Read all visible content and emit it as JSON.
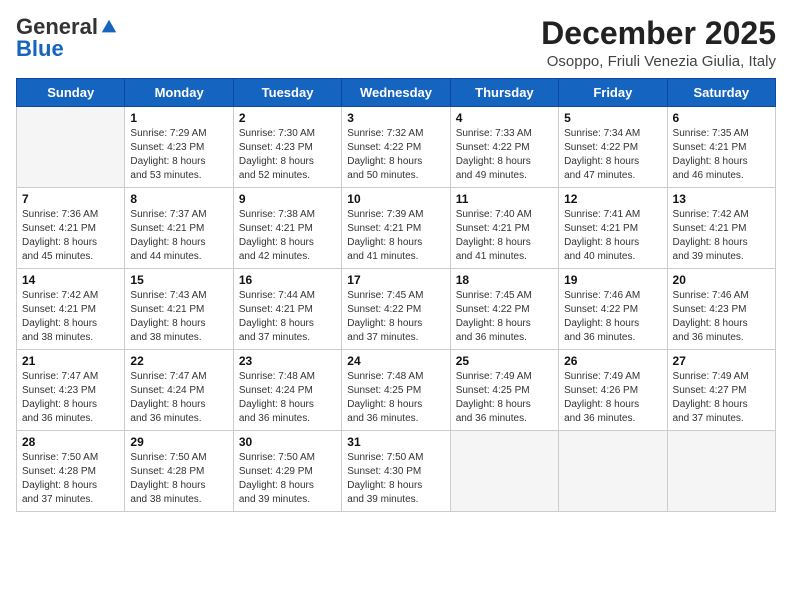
{
  "logo": {
    "general": "General",
    "blue": "Blue"
  },
  "title": "December 2025",
  "subtitle": "Osoppo, Friuli Venezia Giulia, Italy",
  "days_header": [
    "Sunday",
    "Monday",
    "Tuesday",
    "Wednesday",
    "Thursday",
    "Friday",
    "Saturday"
  ],
  "weeks": [
    [
      {
        "day": "",
        "info": ""
      },
      {
        "day": "1",
        "info": "Sunrise: 7:29 AM\nSunset: 4:23 PM\nDaylight: 8 hours\nand 53 minutes."
      },
      {
        "day": "2",
        "info": "Sunrise: 7:30 AM\nSunset: 4:23 PM\nDaylight: 8 hours\nand 52 minutes."
      },
      {
        "day": "3",
        "info": "Sunrise: 7:32 AM\nSunset: 4:22 PM\nDaylight: 8 hours\nand 50 minutes."
      },
      {
        "day": "4",
        "info": "Sunrise: 7:33 AM\nSunset: 4:22 PM\nDaylight: 8 hours\nand 49 minutes."
      },
      {
        "day": "5",
        "info": "Sunrise: 7:34 AM\nSunset: 4:22 PM\nDaylight: 8 hours\nand 47 minutes."
      },
      {
        "day": "6",
        "info": "Sunrise: 7:35 AM\nSunset: 4:21 PM\nDaylight: 8 hours\nand 46 minutes."
      }
    ],
    [
      {
        "day": "7",
        "info": "Sunrise: 7:36 AM\nSunset: 4:21 PM\nDaylight: 8 hours\nand 45 minutes."
      },
      {
        "day": "8",
        "info": "Sunrise: 7:37 AM\nSunset: 4:21 PM\nDaylight: 8 hours\nand 44 minutes."
      },
      {
        "day": "9",
        "info": "Sunrise: 7:38 AM\nSunset: 4:21 PM\nDaylight: 8 hours\nand 42 minutes."
      },
      {
        "day": "10",
        "info": "Sunrise: 7:39 AM\nSunset: 4:21 PM\nDaylight: 8 hours\nand 41 minutes."
      },
      {
        "day": "11",
        "info": "Sunrise: 7:40 AM\nSunset: 4:21 PM\nDaylight: 8 hours\nand 41 minutes."
      },
      {
        "day": "12",
        "info": "Sunrise: 7:41 AM\nSunset: 4:21 PM\nDaylight: 8 hours\nand 40 minutes."
      },
      {
        "day": "13",
        "info": "Sunrise: 7:42 AM\nSunset: 4:21 PM\nDaylight: 8 hours\nand 39 minutes."
      }
    ],
    [
      {
        "day": "14",
        "info": "Sunrise: 7:42 AM\nSunset: 4:21 PM\nDaylight: 8 hours\nand 38 minutes."
      },
      {
        "day": "15",
        "info": "Sunrise: 7:43 AM\nSunset: 4:21 PM\nDaylight: 8 hours\nand 38 minutes."
      },
      {
        "day": "16",
        "info": "Sunrise: 7:44 AM\nSunset: 4:21 PM\nDaylight: 8 hours\nand 37 minutes."
      },
      {
        "day": "17",
        "info": "Sunrise: 7:45 AM\nSunset: 4:22 PM\nDaylight: 8 hours\nand 37 minutes."
      },
      {
        "day": "18",
        "info": "Sunrise: 7:45 AM\nSunset: 4:22 PM\nDaylight: 8 hours\nand 36 minutes."
      },
      {
        "day": "19",
        "info": "Sunrise: 7:46 AM\nSunset: 4:22 PM\nDaylight: 8 hours\nand 36 minutes."
      },
      {
        "day": "20",
        "info": "Sunrise: 7:46 AM\nSunset: 4:23 PM\nDaylight: 8 hours\nand 36 minutes."
      }
    ],
    [
      {
        "day": "21",
        "info": "Sunrise: 7:47 AM\nSunset: 4:23 PM\nDaylight: 8 hours\nand 36 minutes."
      },
      {
        "day": "22",
        "info": "Sunrise: 7:47 AM\nSunset: 4:24 PM\nDaylight: 8 hours\nand 36 minutes."
      },
      {
        "day": "23",
        "info": "Sunrise: 7:48 AM\nSunset: 4:24 PM\nDaylight: 8 hours\nand 36 minutes."
      },
      {
        "day": "24",
        "info": "Sunrise: 7:48 AM\nSunset: 4:25 PM\nDaylight: 8 hours\nand 36 minutes."
      },
      {
        "day": "25",
        "info": "Sunrise: 7:49 AM\nSunset: 4:25 PM\nDaylight: 8 hours\nand 36 minutes."
      },
      {
        "day": "26",
        "info": "Sunrise: 7:49 AM\nSunset: 4:26 PM\nDaylight: 8 hours\nand 36 minutes."
      },
      {
        "day": "27",
        "info": "Sunrise: 7:49 AM\nSunset: 4:27 PM\nDaylight: 8 hours\nand 37 minutes."
      }
    ],
    [
      {
        "day": "28",
        "info": "Sunrise: 7:50 AM\nSunset: 4:28 PM\nDaylight: 8 hours\nand 37 minutes."
      },
      {
        "day": "29",
        "info": "Sunrise: 7:50 AM\nSunset: 4:28 PM\nDaylight: 8 hours\nand 38 minutes."
      },
      {
        "day": "30",
        "info": "Sunrise: 7:50 AM\nSunset: 4:29 PM\nDaylight: 8 hours\nand 39 minutes."
      },
      {
        "day": "31",
        "info": "Sunrise: 7:50 AM\nSunset: 4:30 PM\nDaylight: 8 hours\nand 39 minutes."
      },
      {
        "day": "",
        "info": ""
      },
      {
        "day": "",
        "info": ""
      },
      {
        "day": "",
        "info": ""
      }
    ]
  ]
}
